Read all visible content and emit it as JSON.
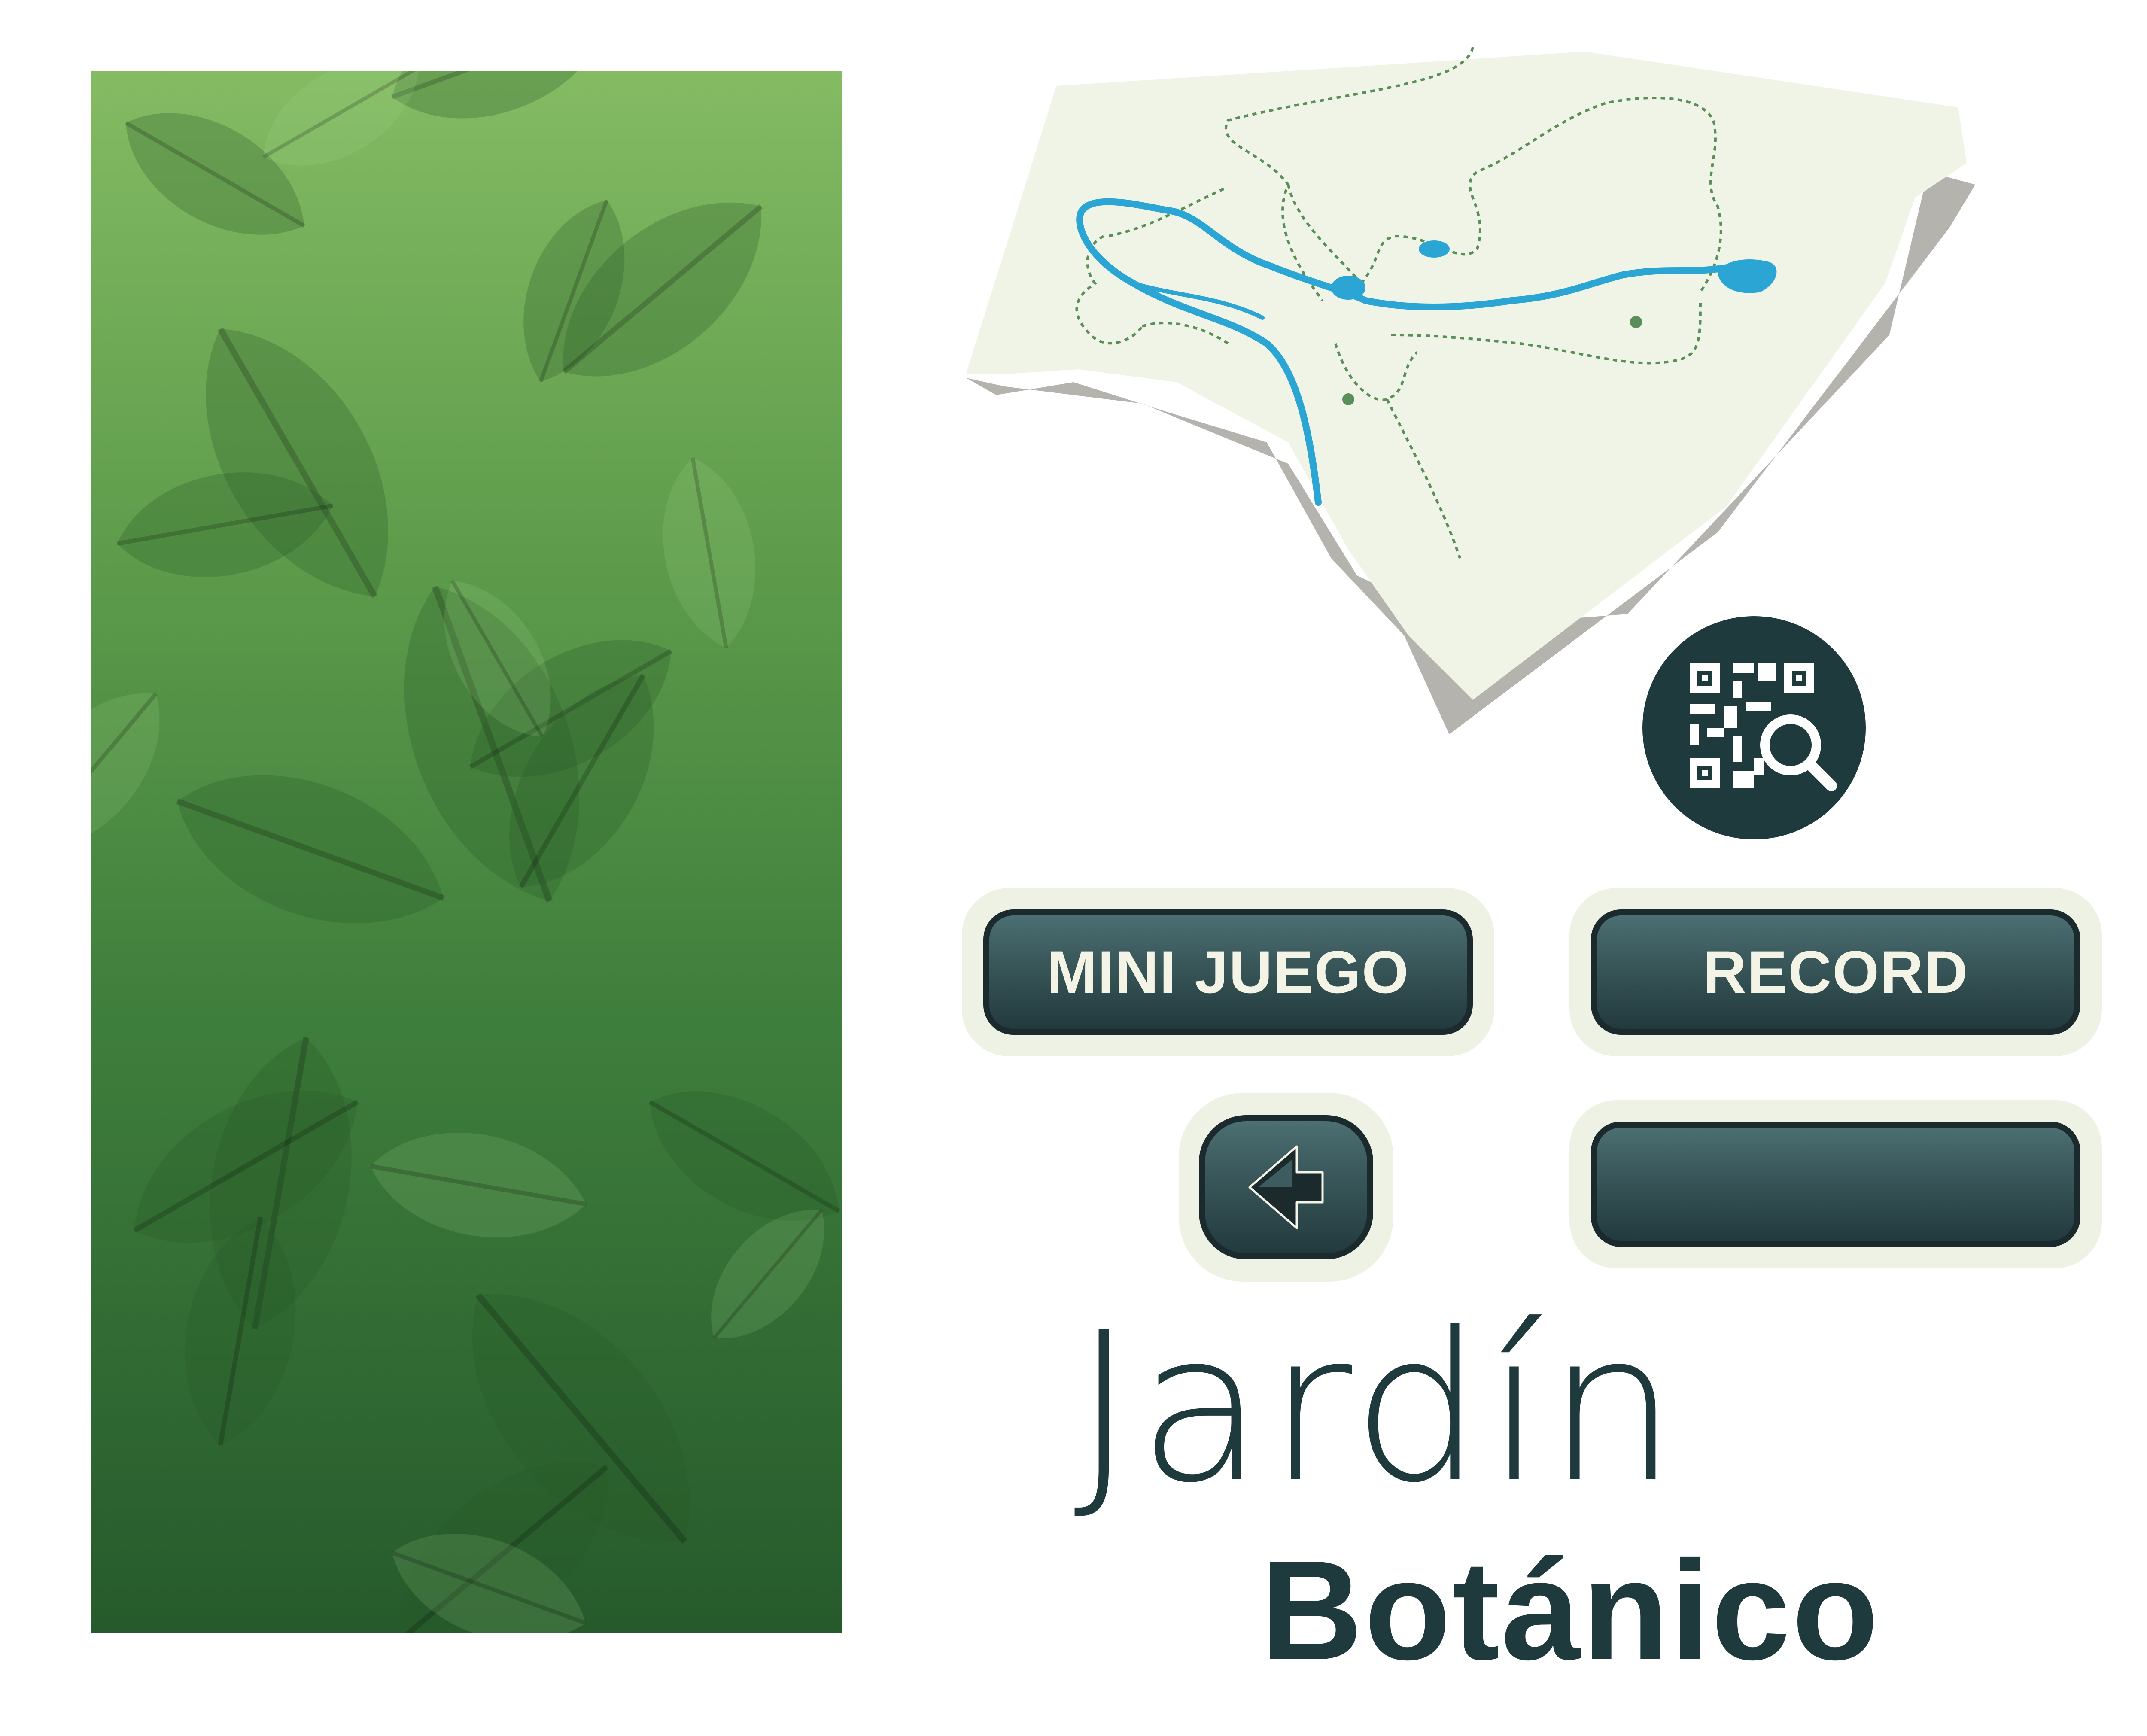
{
  "menu": {
    "mini_game_label": "MINI JUEGO",
    "record_label": "RECORD",
    "blank_label": ""
  },
  "title": {
    "line1": "Jardín",
    "line2": "Botánico"
  },
  "icons": {
    "qr": "qr-scan-icon",
    "back": "arrow-left-icon"
  },
  "colors": {
    "dark_teal": "#1f3a3d",
    "button_light_text": "#f3f3e6",
    "button_frame": "#eef2e4",
    "map_land": "#eff4e6",
    "river": "#2aa5d4",
    "leaf_dark": "#265a2c",
    "leaf_light": "#84bb63"
  }
}
